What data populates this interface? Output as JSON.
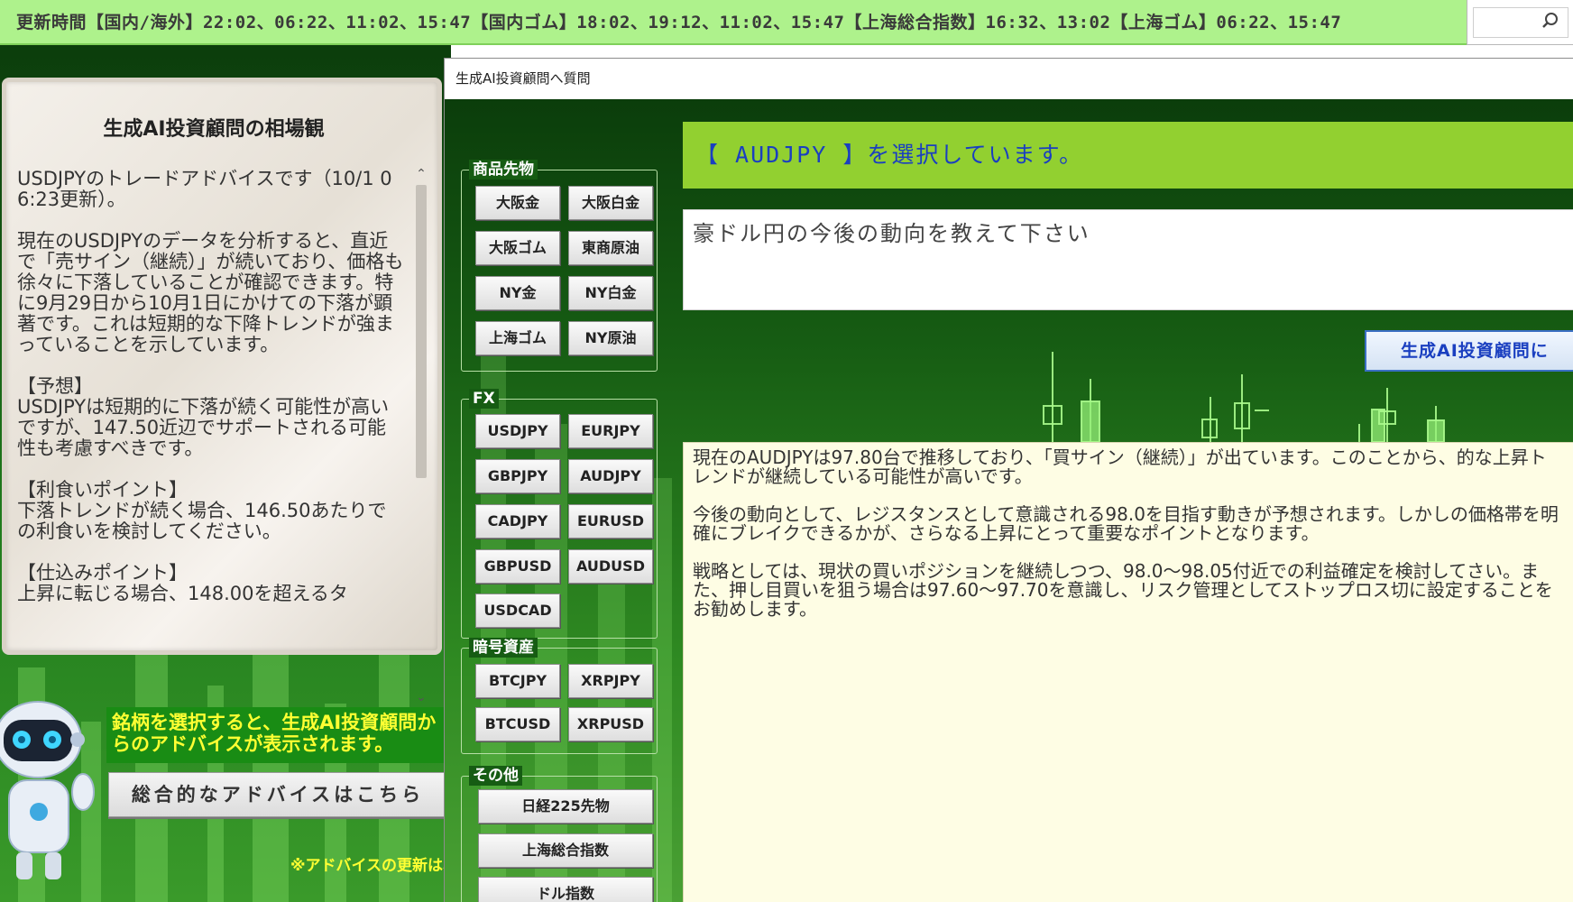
{
  "ticker": {
    "text": "更新時間【国内/海外】22:02、06:22、11:02、15:47【国内ゴム】18:02、19:12、11:02、15:47【上海総合指数】16:32、13:02【上海ゴム】06:22、15:47"
  },
  "advice_panel": {
    "title": "生成AI投資顧問の相場観",
    "text": "USDJPYのトレードアドバイスです（10/1 06:23更新）。\n\n現在のUSDJPYのデータを分析すると、直近で「売サイン（継続）」が続いており、価格も徐々に下落していることが確認できます。特に9月29日から10月1日にかけての下落が顕著です。これは短期的な下降トレンドが強まっていることを示しています。\n\n【予想】\nUSDJPYは短期的に下落が続く可能性が高いですが、147.50近辺でサポートされる可能性も考慮すべきです。\n\n【利食いポイント】\n下落トレンドが続く場合、146.50あたりでの利食いを検討してください。\n\n【仕込みポイント】\n上昇に転じる場合、148.00を超えるタ"
  },
  "bottom_left": {
    "hint": "銘柄を選択すると、生成AI投資顧問からのアドバイスが表示されます。",
    "overall_button": "総合的なアドバイスはこちら",
    "note": "※アドバイスの更新は、"
  },
  "dialog": {
    "title": "生成AI投資顧問へ質問",
    "groups": {
      "commodities": {
        "label": "商品先物",
        "buttons": [
          "大阪金",
          "大阪白金",
          "大阪ゴム",
          "東商原油",
          "NY金",
          "NY白金",
          "上海ゴム",
          "NY原油"
        ]
      },
      "fx": {
        "label": "FX",
        "buttons": [
          "USDJPY",
          "EURJPY",
          "GBPJPY",
          "AUDJPY",
          "CADJPY",
          "EURUSD",
          "GBPUSD",
          "AUDUSD",
          "USDCAD"
        ]
      },
      "crypto": {
        "label": "暗号資産",
        "buttons": [
          "BTCJPY",
          "XRPJPY",
          "BTCUSD",
          "XRPUSD"
        ]
      },
      "other": {
        "label": "その他",
        "buttons": [
          "日経225先物",
          "上海総合指数",
          "ドル指数"
        ]
      }
    },
    "selected_banner": "【 AUDJPY 】を選択しています。",
    "question": "豪ドル円の今後の動向を教えて下さい",
    "ask_button": "生成AI投資顧問に",
    "answer": "現在のAUDJPYは97.80台で推移しており、「買サイン（継続）」が出ています。このことから、的な上昇トレンドが継続している可能性が高いです。\n\n今後の動向として、レジスタンスとして意識される98.0を目指す動きが予想されます。しかしの価格帯を明確にブレイクできるかが、さらなる上昇にとって重要なポイントとなります。\n\n戦略としては、現状の買いポジションを継続しつつ、98.0～98.05付近での利益確定を検討してさい。また、押し目買いを狙う場合は97.60～97.70を意識し、リスク管理としてストップロス切に設定することをお勧めします。"
  },
  "colors": {
    "ticker_bg": "#aef28c",
    "banner_bg": "#92d030",
    "banner_text": "#1a3fc0",
    "answer_bg": "#fefde4",
    "hint_text": "#ffff33"
  },
  "icons": {
    "search": "search-icon",
    "scroll_up": "chevron-up-icon",
    "scroll_down": "chevron-down-icon",
    "robot": "robot-mascot-icon"
  }
}
